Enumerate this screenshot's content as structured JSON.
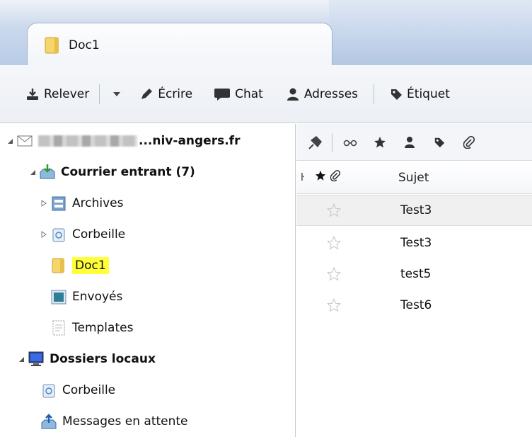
{
  "tab": {
    "title": "Doc1"
  },
  "toolbar": {
    "get_label": "Relever",
    "write_label": "Écrire",
    "chat_label": "Chat",
    "address_label": "Adresses",
    "tag_label": "Étiquet"
  },
  "folders": {
    "account_label": "...niv-angers.fr",
    "inbox_label": "Courrier entrant (7)",
    "archives_label": "Archives",
    "trash_label": "Corbeille",
    "doc1_label": "Doc1",
    "sent_label": "Envoyés",
    "templates_label": "Templates",
    "local_label": "Dossiers locaux",
    "local_trash_label": "Corbeille",
    "outbox_label": "Messages en attente"
  },
  "messages": {
    "header_thread": "ŀ",
    "header_subject": "Sujet",
    "rows": [
      {
        "subject": "Test3"
      },
      {
        "subject": "Test3"
      },
      {
        "subject": "test5"
      },
      {
        "subject": "Test6"
      }
    ]
  },
  "colors": {
    "highlight": "#ffff3a",
    "selected_row": "#f0f0f0"
  }
}
